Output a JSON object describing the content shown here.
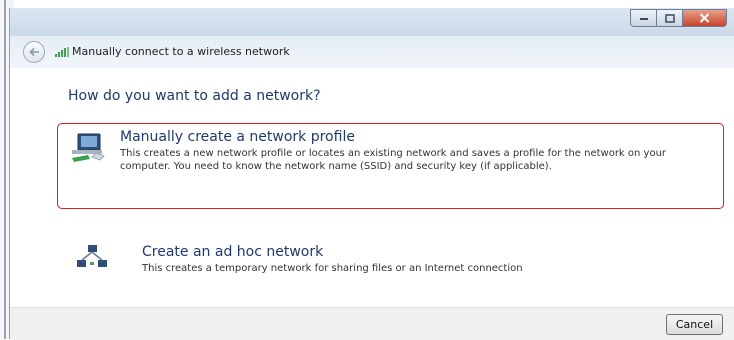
{
  "window": {
    "title": "Manually connect to a wireless network",
    "icons": {
      "back": "back-arrow-icon",
      "network": "wireless-signal-icon",
      "minimize": "minimize-icon",
      "maximize": "maximize-icon",
      "close": "close-icon"
    }
  },
  "content": {
    "question": "How do you want to add a network?",
    "options": [
      {
        "title": "Manually create a network profile",
        "description": "This creates a new network profile or locates an existing network and saves a profile for the network on your computer. You need to know the network name (SSID) and security key (if applicable).",
        "icon": "network-profile-icon",
        "highlighted": true
      },
      {
        "title": "Create an ad hoc network",
        "description": "This creates a temporary network for sharing files or an Internet connection",
        "icon": "ad-hoc-network-icon",
        "highlighted": false
      }
    ]
  },
  "footer": {
    "cancel_label": "Cancel"
  },
  "colors": {
    "highlight_border": "#d92020",
    "heading_text": "#1e3a6e",
    "close_button": "#c7432a"
  }
}
